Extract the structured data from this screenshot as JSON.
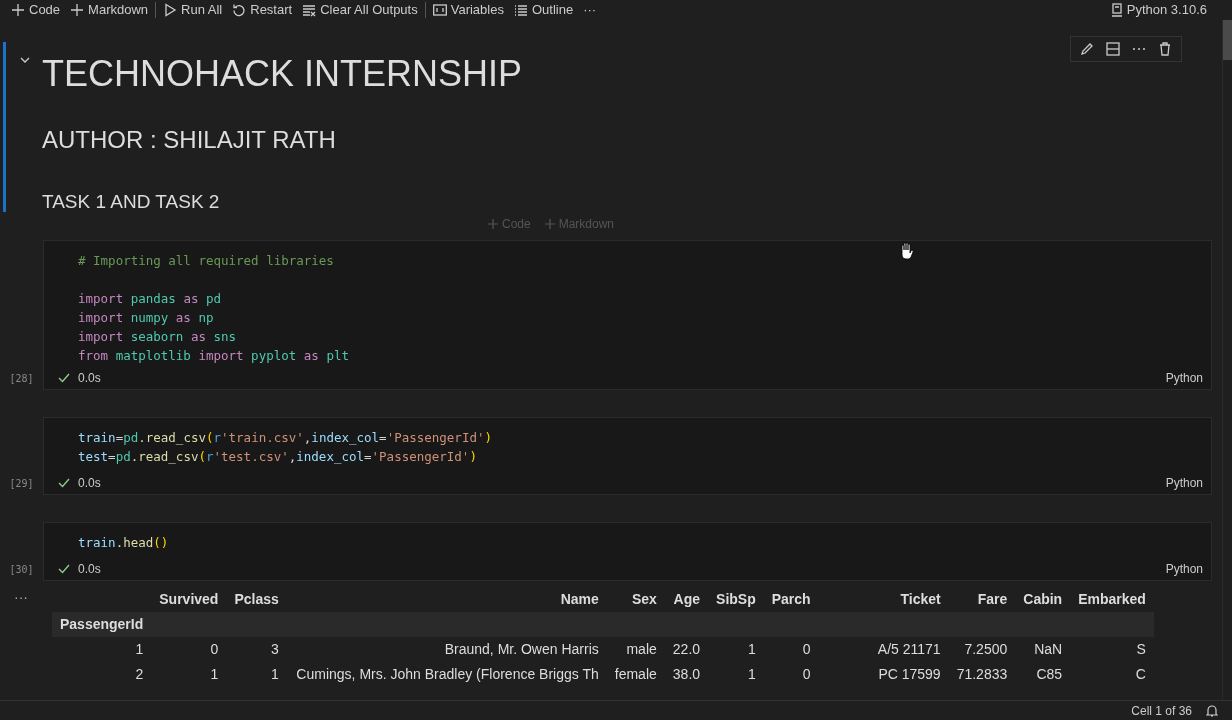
{
  "toolbar": {
    "items": [
      {
        "label": "Code"
      },
      {
        "label": "Markdown"
      },
      {
        "label": "Run All"
      },
      {
        "label": "Restart"
      },
      {
        "label": "Clear All Outputs"
      },
      {
        "label": "Variables"
      },
      {
        "label": "Outline"
      },
      {
        "label": "···"
      }
    ],
    "kernel": "Python 3.10.6"
  },
  "markdown_cell": {
    "title": "TECHNOHACK INTERNSHIP",
    "author": "AUTHOR : SHILAJIT RATH",
    "task": "TASK 1 AND TASK 2"
  },
  "insert_bar": [
    "Code",
    "Markdown"
  ],
  "cells": [
    {
      "count": "[28]",
      "status": "0.0s",
      "language": "Python",
      "blocks": [
        [
          [
            {
              "t": "# Importing all required libraries",
              "kind": "comment"
            }
          ]
        ],
        [
          [
            {
              "t": "import",
              "kind": "keyword"
            },
            {
              "t": " pandas ",
              "kind": "module"
            },
            {
              "t": "as",
              "kind": "keyword"
            },
            {
              "t": " pd",
              "kind": "module"
            }
          ],
          [
            {
              "t": "import",
              "kind": "keyword"
            },
            {
              "t": " numpy ",
              "kind": "module"
            },
            {
              "t": "as",
              "kind": "keyword"
            },
            {
              "t": " np",
              "kind": "module"
            }
          ],
          [
            {
              "t": "import",
              "kind": "keyword"
            },
            {
              "t": " seaborn ",
              "kind": "module"
            },
            {
              "t": "as",
              "kind": "keyword"
            },
            {
              "t": " sns",
              "kind": "module"
            }
          ],
          [
            {
              "t": "from",
              "kind": "keyword"
            },
            {
              "t": " matplotlib ",
              "kind": "module"
            },
            {
              "t": "import",
              "kind": "keyword"
            },
            {
              "t": " pyplot ",
              "kind": "module"
            },
            {
              "t": "as",
              "kind": "keyword"
            },
            {
              "t": " plt",
              "kind": "module"
            }
          ]
        ]
      ]
    },
    {
      "count": "[29]",
      "status": "0.0s",
      "language": "Python",
      "blocks": [
        [
          [
            {
              "t": "train",
              "kind": "name"
            },
            {
              "t": "=",
              "kind": "plain"
            },
            {
              "t": "pd",
              "kind": "module"
            },
            {
              "t": ".read_csv",
              "kind": "func"
            },
            {
              "t": "(",
              "kind": "paren"
            },
            {
              "t": "r",
              "kind": "prefix"
            },
            {
              "t": "'train.csv'",
              "kind": "string"
            },
            {
              "t": ",",
              "kind": "plain"
            },
            {
              "t": "index_col",
              "kind": "name"
            },
            {
              "t": "=",
              "kind": "plain"
            },
            {
              "t": "'PassengerId'",
              "kind": "string"
            },
            {
              "t": ")",
              "kind": "paren"
            }
          ],
          [
            {
              "t": "test",
              "kind": "name"
            },
            {
              "t": "=",
              "kind": "plain"
            },
            {
              "t": "pd",
              "kind": "module"
            },
            {
              "t": ".read_csv",
              "kind": "func"
            },
            {
              "t": "(",
              "kind": "paren"
            },
            {
              "t": "r",
              "kind": "prefix"
            },
            {
              "t": "'test.csv'",
              "kind": "string"
            },
            {
              "t": ",",
              "kind": "plain"
            },
            {
              "t": "index_col",
              "kind": "name"
            },
            {
              "t": "=",
              "kind": "plain"
            },
            {
              "t": "'PassengerId'",
              "kind": "string"
            },
            {
              "t": ")",
              "kind": "paren"
            }
          ]
        ]
      ]
    },
    {
      "count": "[30]",
      "status": "0.0s",
      "language": "Python",
      "blocks": [
        [
          [
            {
              "t": "train",
              "kind": "name"
            },
            {
              "t": ".head",
              "kind": "func"
            },
            {
              "t": "()",
              "kind": "paren"
            }
          ]
        ]
      ]
    }
  ],
  "output": {
    "more": "···",
    "columns": [
      "",
      "Survived",
      "Pclass",
      "Name",
      "Sex",
      "Age",
      "SibSp",
      "Parch",
      "Ticket",
      "Fare",
      "Cabin",
      "Embarked"
    ],
    "index_name": "PassengerId",
    "rows": [
      [
        "1",
        "0",
        "3",
        "Braund, Mr. Owen Harris",
        "male",
        "22.0",
        "1",
        "0",
        "A/5 21171",
        "7.2500",
        "NaN",
        "S"
      ],
      [
        "2",
        "1",
        "1",
        "Cumings, Mrs. John Bradley (Florence Briggs Th",
        "female",
        "38.0",
        "1",
        "0",
        "PC 17599",
        "71.2833",
        "C85",
        "C"
      ]
    ]
  },
  "status_bar": {
    "cell": "Cell 1 of 36"
  }
}
